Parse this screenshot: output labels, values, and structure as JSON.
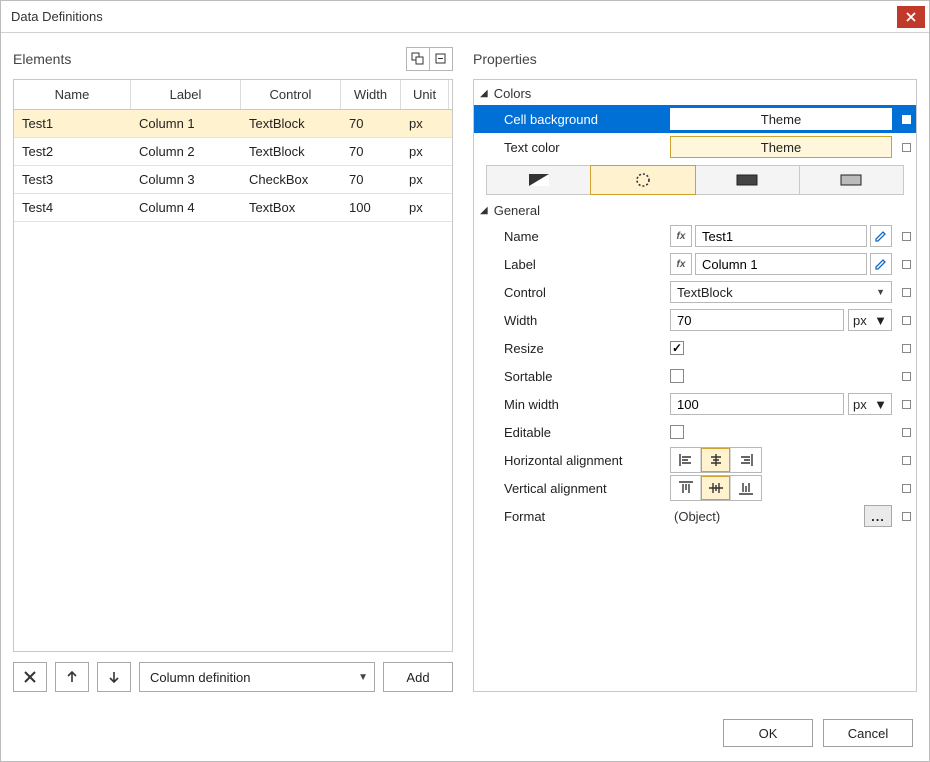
{
  "dialog": {
    "title": "Data Definitions"
  },
  "panes": {
    "elements": "Elements",
    "properties": "Properties"
  },
  "table": {
    "headers": {
      "name": "Name",
      "label": "Label",
      "control": "Control",
      "width": "Width",
      "unit": "Unit"
    },
    "rows": [
      {
        "name": "Test1",
        "label": "Column 1",
        "control": "TextBlock",
        "width": "70",
        "unit": "px",
        "selected": true
      },
      {
        "name": "Test2",
        "label": "Column 2",
        "control": "TextBlock",
        "width": "70",
        "unit": "px",
        "selected": false
      },
      {
        "name": "Test3",
        "label": "Column 3",
        "control": "CheckBox",
        "width": "70",
        "unit": "px",
        "selected": false
      },
      {
        "name": "Test4",
        "label": "Column 4",
        "control": "TextBox",
        "width": "100",
        "unit": "px",
        "selected": false
      }
    ]
  },
  "footer": {
    "combo": "Column definition",
    "add": "Add"
  },
  "props": {
    "sections": {
      "colors": "Colors",
      "general": "General"
    },
    "colors": {
      "cellbg": {
        "label": "Cell background",
        "value": "Theme"
      },
      "textcol": {
        "label": "Text color",
        "value": "Theme"
      }
    },
    "general": {
      "name": {
        "label": "Name",
        "value": "Test1"
      },
      "labelp": {
        "label": "Label",
        "value": "Column 1"
      },
      "control": {
        "label": "Control",
        "value": "TextBlock"
      },
      "width": {
        "label": "Width",
        "value": "70",
        "unit": "px"
      },
      "resize": {
        "label": "Resize",
        "checked": true
      },
      "sortable": {
        "label": "Sortable",
        "checked": false
      },
      "minwidth": {
        "label": "Min width",
        "value": "100",
        "unit": "px"
      },
      "editable": {
        "label": "Editable",
        "checked": false
      },
      "halign": {
        "label": "Horizontal alignment",
        "active": 1
      },
      "valign": {
        "label": "Vertical alignment",
        "active": 1
      },
      "format": {
        "label": "Format",
        "value": "(Object)"
      }
    }
  },
  "buttons": {
    "ok": "OK",
    "cancel": "Cancel",
    "ell": "..."
  }
}
